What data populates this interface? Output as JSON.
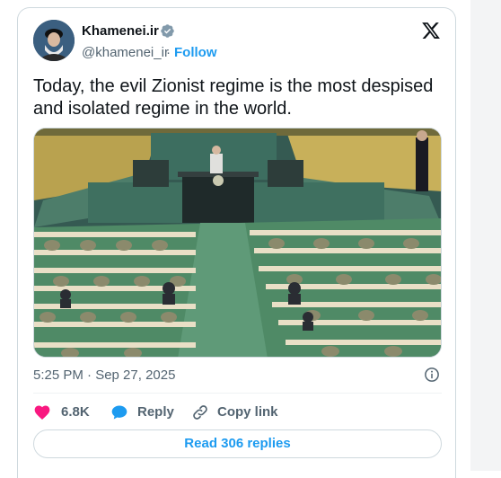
{
  "tweet": {
    "author": {
      "display_name": "Khamenei.ir",
      "handle": "@khamenei_ir",
      "separator": "·",
      "follow_label": "Follow",
      "verified": true
    },
    "text": "Today, the evil Zionist regime is the most despised and isolated regime in the world.",
    "timestamp": "5:25 PM · Sep 27, 2025",
    "actions": {
      "like_count": "6.8K",
      "reply_label": "Reply",
      "copy_link_label": "Copy link"
    },
    "read_replies_label": "Read 306 replies"
  },
  "colors": {
    "accent": "#1d9bf0",
    "like": "#f91880",
    "text_primary": "#0f1419",
    "text_secondary": "#536471"
  },
  "icons": {
    "platform": "x-logo-icon",
    "verified": "verified-badge-icon",
    "info": "info-icon",
    "like": "heart-icon",
    "reply": "speech-bubble-icon",
    "copy_link": "link-icon"
  }
}
